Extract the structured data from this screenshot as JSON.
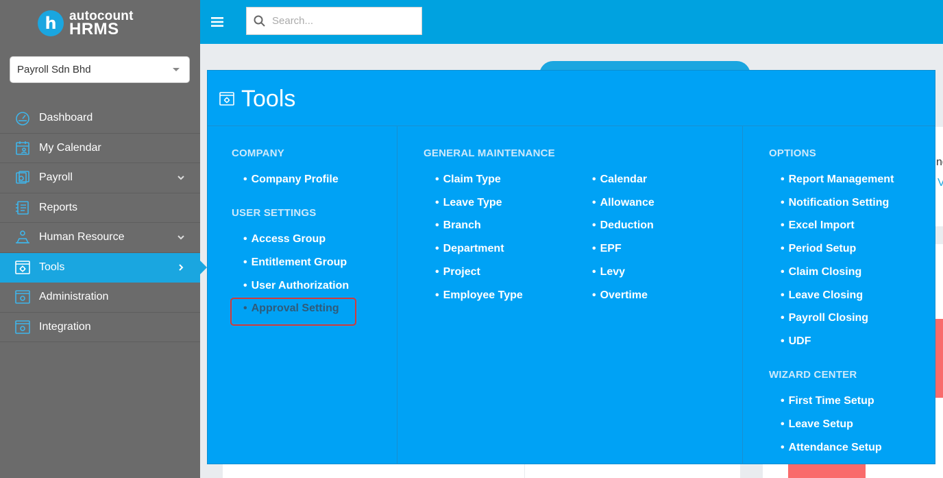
{
  "brand": {
    "logo_letter": "h",
    "line1": "autocount",
    "line2": "HRMS",
    "accent_color": "#00a2e0"
  },
  "company_select": {
    "value": "Payroll Sdn Bhd"
  },
  "search": {
    "placeholder": "Search..."
  },
  "nav": {
    "items": [
      {
        "label": "Dashboard",
        "icon": "dashboard-icon"
      },
      {
        "label": "My Calendar",
        "icon": "calendar-user-icon"
      },
      {
        "label": "Payroll",
        "icon": "payroll-icon",
        "expandable": true
      },
      {
        "label": "Reports",
        "icon": "reports-icon"
      },
      {
        "label": "Human Resource",
        "icon": "human-resource-icon",
        "expandable": true
      },
      {
        "label": "Tools",
        "icon": "tools-icon",
        "active": true
      },
      {
        "label": "Administration",
        "icon": "administration-icon"
      },
      {
        "label": "Integration",
        "icon": "integration-icon"
      }
    ]
  },
  "mega": {
    "title": "Tools",
    "company": {
      "heading": "COMPANY",
      "items": [
        "Company Profile"
      ]
    },
    "user_settings": {
      "heading": "USER SETTINGS",
      "items": [
        "Access Group",
        "Entitlement Group",
        "User Authorization",
        "Approval Setting"
      ]
    },
    "general_maintenance": {
      "heading": "GENERAL MAINTENANCE",
      "col1": [
        "Claim Type",
        "Leave Type",
        "Branch",
        "Department",
        "Project",
        "Employee Type"
      ],
      "col2": [
        "Calendar",
        "Allowance",
        "Deduction",
        "EPF",
        "Levy",
        "Overtime"
      ]
    },
    "options": {
      "heading": "OPTIONS",
      "items": [
        "Report Management",
        "Notification Setting",
        "Excel Import",
        "Period Setup",
        "Claim Closing",
        "Leave Closing",
        "Payroll Closing",
        "UDF"
      ]
    },
    "wizard_center": {
      "heading": "WIZARD CENTER",
      "items": [
        "First Time Setup",
        "Leave Setup",
        "Attendance Setup"
      ]
    }
  },
  "background_peek": {
    "text1": "ng",
    "text2": "V"
  }
}
